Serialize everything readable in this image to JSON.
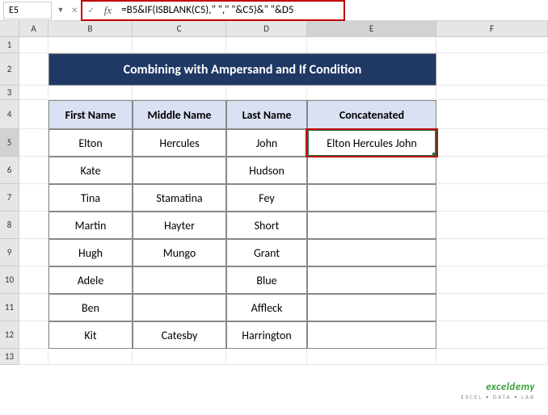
{
  "nameBox": "E5",
  "formula": "=B5&IF(ISBLANK(C5),\" \",\" \"&C5)&\" \"&D5",
  "fxLabel": "fx",
  "columns": [
    "A",
    "B",
    "C",
    "D",
    "E",
    "F"
  ],
  "rows": [
    "1",
    "2",
    "3",
    "4",
    "5",
    "6",
    "7",
    "8",
    "9",
    "10",
    "11",
    "12",
    "13"
  ],
  "title": "Combining with Ampersand and If Condition",
  "headers": {
    "first": "First Name",
    "middle": "Middle Name",
    "last": "Last Name",
    "concat": "Concatenated"
  },
  "table": [
    {
      "first": "Elton",
      "middle": "Hercules",
      "last": "John",
      "concat": "Elton Hercules John"
    },
    {
      "first": "Kate",
      "middle": "",
      "last": "Hudson",
      "concat": ""
    },
    {
      "first": "Tina",
      "middle": "Stamatina",
      "last": "Fey",
      "concat": ""
    },
    {
      "first": "Martin",
      "middle": "Hayter",
      "last": "Short",
      "concat": ""
    },
    {
      "first": "Hugh",
      "middle": "Mungo",
      "last": "Grant",
      "concat": ""
    },
    {
      "first": "Adele",
      "middle": "",
      "last": "Blue",
      "concat": ""
    },
    {
      "first": "Ben",
      "middle": "",
      "last": "Affleck",
      "concat": ""
    },
    {
      "first": "Kit",
      "middle": "Catesby",
      "last": "Harrington",
      "concat": ""
    }
  ],
  "watermark": {
    "line1": "exceldemy",
    "line2": "EXCEL • DATA • LAB"
  }
}
